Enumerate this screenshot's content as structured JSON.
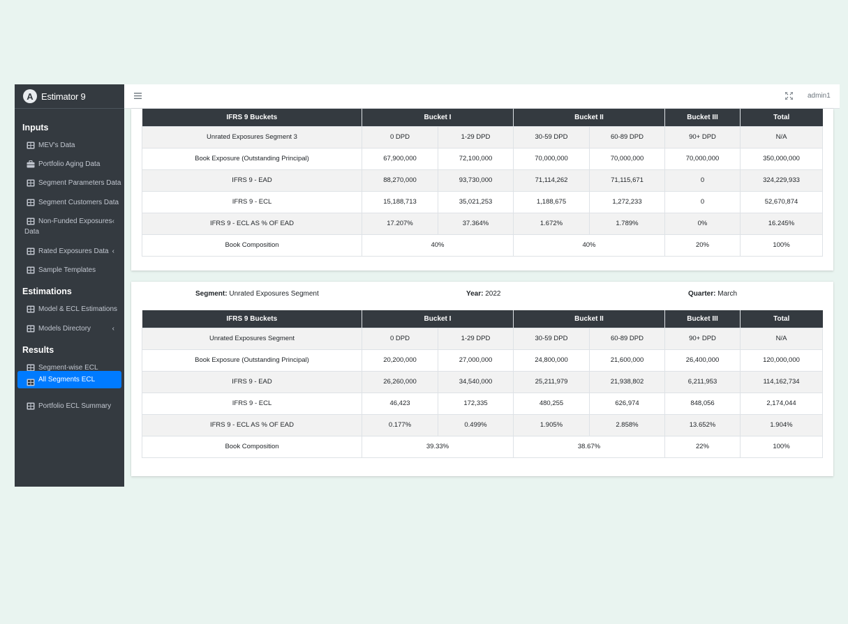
{
  "brand": {
    "logo_letter": "A",
    "name": "Estimator 9"
  },
  "sidebar": {
    "sections": [
      {
        "header": "Inputs",
        "items": [
          {
            "label": "MEV's Data",
            "icon": "table-icon"
          },
          {
            "label": "Portfolio Aging Data",
            "icon": "briefcase-icon"
          },
          {
            "label": "Segment Parameters Data",
            "icon": "table-icon"
          },
          {
            "label": "Segment Customers Data",
            "icon": "table-icon"
          },
          {
            "label": "Non-Funded Exposures",
            "label2": "Data",
            "icon": "table-icon",
            "chevron": "‹"
          },
          {
            "label": "Rated Exposures Data",
            "icon": "table-icon",
            "chevron": "‹"
          },
          {
            "label": "Sample Templates",
            "icon": "table-icon"
          }
        ]
      },
      {
        "header": "Estimations",
        "items": [
          {
            "label": "Model & ECL Estimations",
            "icon": "table-icon"
          },
          {
            "label": "Models Directory",
            "icon": "table-icon",
            "chevron": "‹"
          }
        ]
      },
      {
        "header": "Results",
        "items": [
          {
            "label": "Segment-wise ECL",
            "icon": "table-icon"
          },
          {
            "label": "All Segments ECL",
            "icon": "table-icon",
            "active": true
          },
          {
            "label": "Portfolio ECL Summary",
            "icon": "table-icon"
          }
        ]
      }
    ]
  },
  "topbar": {
    "user": "admin1"
  },
  "colors": {
    "sidebar_bg": "#343a40",
    "active": "#007bff",
    "header_bg": "#343a40",
    "page_bg": "#e9f4f0"
  },
  "table_headers": [
    "IFRS 9 Buckets",
    "Bucket I",
    "Bucket II",
    "Bucket III",
    "Total"
  ],
  "card1": {
    "rows": [
      [
        "Unrated Exposures Segment 3",
        "0 DPD",
        "1-29 DPD",
        "30-59 DPD",
        "60-89 DPD",
        "90+ DPD",
        "N/A"
      ],
      [
        "Book Exposure (Outstanding Principal)",
        "67,900,000",
        "72,100,000",
        "70,000,000",
        "70,000,000",
        "70,000,000",
        "350,000,000"
      ],
      [
        "IFRS 9 - EAD",
        "88,270,000",
        "93,730,000",
        "71,114,262",
        "71,115,671",
        "0",
        "324,229,933"
      ],
      [
        "IFRS 9 - ECL",
        "15,188,713",
        "35,021,253",
        "1,188,675",
        "1,272,233",
        "0",
        "52,670,874"
      ],
      [
        "IFRS 9 - ECL AS % OF EAD",
        "17.207%",
        "37.364%",
        "1.672%",
        "1.789%",
        "0%",
        "16.245%"
      ]
    ],
    "composition": [
      "Book Composition",
      "40%",
      "40%",
      "20%",
      "100%"
    ]
  },
  "card2": {
    "segment_label": "Segment:",
    "segment_value": "Unrated Exposures Segment",
    "year_label": "Year:",
    "year_value": "2022",
    "quarter_label": "Quarter:",
    "quarter_value": "March",
    "rows": [
      [
        "Unrated Exposures Segment",
        "0 DPD",
        "1-29 DPD",
        "30-59 DPD",
        "60-89 DPD",
        "90+ DPD",
        "N/A"
      ],
      [
        "Book Exposure (Outstanding Principal)",
        "20,200,000",
        "27,000,000",
        "24,800,000",
        "21,600,000",
        "26,400,000",
        "120,000,000"
      ],
      [
        "IFRS 9 - EAD",
        "26,260,000",
        "34,540,000",
        "25,211,979",
        "21,938,802",
        "6,211,953",
        "114,162,734"
      ],
      [
        "IFRS 9 - ECL",
        "46,423",
        "172,335",
        "480,255",
        "626,974",
        "848,056",
        "2,174,044"
      ],
      [
        "IFRS 9 - ECL AS % OF EAD",
        "0.177%",
        "0.499%",
        "1.905%",
        "2.858%",
        "13.652%",
        "1.904%"
      ]
    ],
    "composition": [
      "Book Composition",
      "39.33%",
      "38.67%",
      "22%",
      "100%"
    ]
  }
}
